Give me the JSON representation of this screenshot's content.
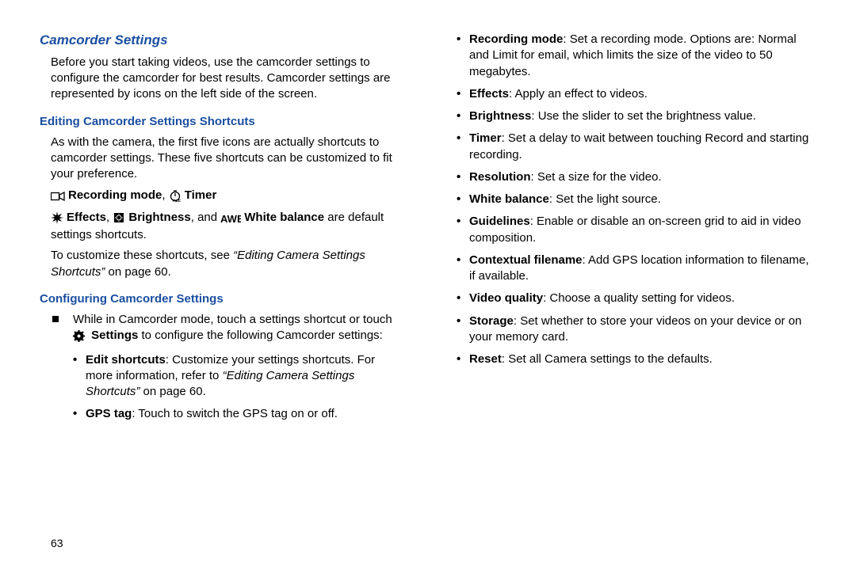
{
  "left": {
    "h2": "Camcorder Settings",
    "p1": "Before you start taking videos, use the camcorder settings to configure the camcorder for best results. Camcorder settings are represented by icons on the left side of the screen.",
    "h3a": "Editing Camcorder Settings Shortcuts",
    "p2": "As with the camera, the first five icons are actually shortcuts to camcorder settings. These five shortcuts can be customized to fit your preference.",
    "rec_mode": "Recording mode",
    "comma": ", ",
    "timer": "Timer",
    "effects": "Effects",
    "brightness": "Brightness",
    "and": ", and ",
    "white_balance": "White balance",
    "p3_tail": " are default settings shortcuts.",
    "p4_pre": "To customize these shortcuts, see ",
    "p4_em": "“Editing Camera Settings Shortcuts”",
    "p4_post": " on page 60.",
    "h3b": "Configuring Camcorder Settings",
    "sq_pre": "While in Camcorder mode, touch a settings shortcut or touch ",
    "sq_settings": " Settings",
    "sq_post": " to configure the following Camcorder settings:",
    "b1_label": "Edit shortcuts",
    "b1_text": ": Customize your settings shortcuts. For more information, refer to ",
    "b1_em": "“Editing Camera Settings Shortcuts”",
    "b1_post": " on page 60.",
    "b2_label": "GPS tag",
    "b2_text": ": Touch to switch the GPS tag on or off."
  },
  "right": {
    "r1_label": "Recording mode",
    "r1_text": ": Set a recording mode. Options are: Normal and Limit for email, which limits the size of the video to 50 megabytes.",
    "r2_label": "Effects",
    "r2_text": ": Apply an effect to videos.",
    "r3_label": "Brightness",
    "r3_text": ": Use the slider to set the brightness value.",
    "r4_label": "Timer",
    "r4_text": ": Set a delay to wait between touching Record and starting recording.",
    "r5_label": "Resolution",
    "r5_text": ": Set a size for the video.",
    "r6_label": "White balance",
    "r6_text": ": Set the light source.",
    "r7_label": "Guidelines",
    "r7_text": ": Enable or disable an on-screen grid to aid in video composition.",
    "r8_label": "Contextual filename",
    "r8_text": ": Add GPS location information to filename, if available.",
    "r9_label": "Video quality",
    "r9_text": ": Choose a quality setting for videos.",
    "r10_label": "Storage",
    "r10_text": ": Set whether to store your videos on your device or on your memory card.",
    "r11_label": "Reset",
    "r11_text": ": Set all Camera settings to the defaults."
  },
  "pagenum": "63"
}
